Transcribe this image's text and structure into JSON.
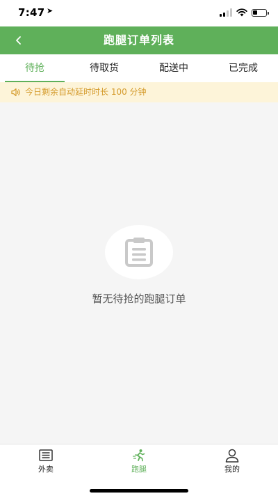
{
  "status_bar": {
    "time": "7:47",
    "signal_icon": "signal-icon",
    "wifi_icon": "wifi-icon",
    "battery_icon": "battery-icon",
    "battery_level": 0.35,
    "location_icon": "location-arrow-icon"
  },
  "nav": {
    "title": "跑腿订单列表",
    "back_icon": "back-arrow-icon",
    "background": "#5fb05a"
  },
  "tabs": [
    {
      "label": "待抢",
      "active": true
    },
    {
      "label": "待取货",
      "active": false
    },
    {
      "label": "配送中",
      "active": false
    },
    {
      "label": "已完成",
      "active": false
    }
  ],
  "notice": {
    "icon": "speaker-icon",
    "text": "今日剩余自动延时时长 100 分钟",
    "text_color": "#d49a2a",
    "background": "#fdf4d9"
  },
  "empty_state": {
    "icon": "clipboard-icon",
    "message": "暂无待抢的跑腿订单"
  },
  "bottom_nav": [
    {
      "label": "外卖",
      "icon": "list-icon",
      "active": false
    },
    {
      "label": "跑腿",
      "icon": "runner-icon",
      "active": true
    },
    {
      "label": "我的",
      "icon": "user-icon",
      "active": false
    }
  ],
  "colors": {
    "accent": "#5fb05a",
    "page_background": "#f5f5f5"
  }
}
